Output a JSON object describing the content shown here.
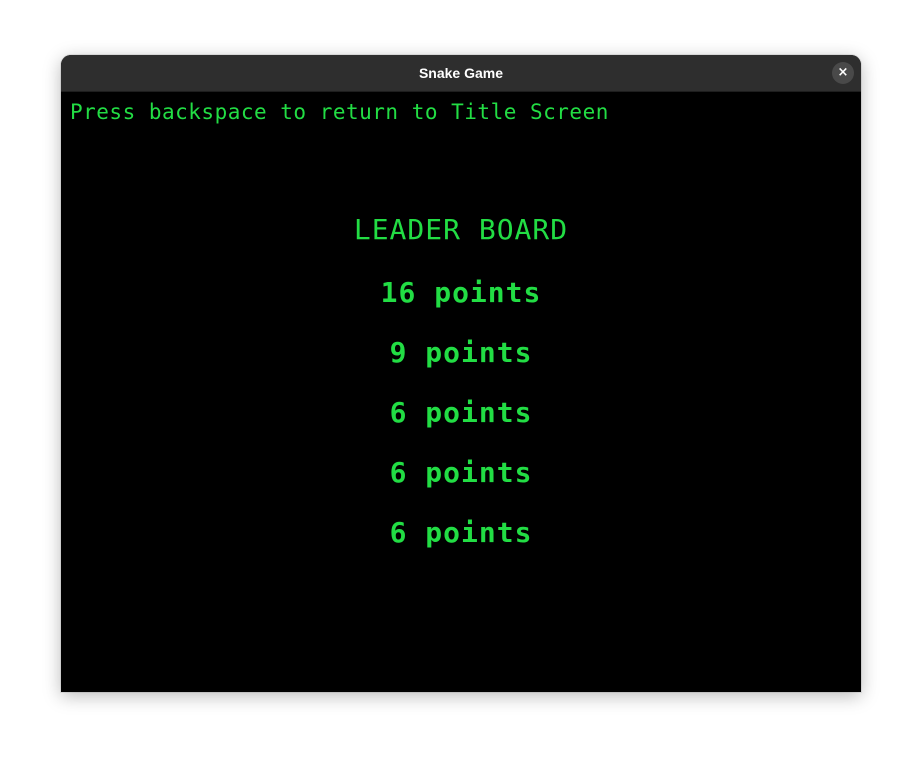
{
  "window": {
    "title": "Snake Game",
    "close_icon": "×"
  },
  "game": {
    "hint": "Press backspace to return to Title Screen",
    "leaderboard_title": "LEADER BOARD",
    "scores": [
      "16 points",
      "9 points",
      "6 points",
      "6 points",
      "6 points"
    ]
  },
  "colors": {
    "text": "#22dd44",
    "background": "#000000",
    "titlebar": "#2e2e2e"
  }
}
